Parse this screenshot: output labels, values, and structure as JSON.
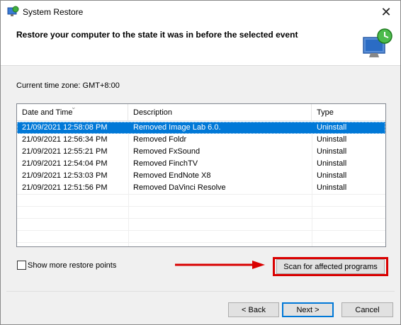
{
  "window": {
    "title": "System Restore",
    "close_glyph": "✕"
  },
  "header": {
    "text": "Restore your computer to the state it was in before the selected event"
  },
  "timezone": "Current time zone: GMT+8:00",
  "table": {
    "columns": [
      "Date and Time",
      "Description",
      "Type"
    ],
    "rows": [
      {
        "date": "21/09/2021 12:58:08 PM",
        "description": "Removed Image Lab 6.0.",
        "type": "Uninstall",
        "selected": true
      },
      {
        "date": "21/09/2021 12:56:34 PM",
        "description": "Removed Foldr",
        "type": "Uninstall"
      },
      {
        "date": "21/09/2021 12:55:21 PM",
        "description": "Removed FxSound",
        "type": "Uninstall"
      },
      {
        "date": "21/09/2021 12:54:04 PM",
        "description": "Removed FinchTV",
        "type": "Uninstall"
      },
      {
        "date": "21/09/2021 12:53:03 PM",
        "description": "Removed EndNote X8",
        "type": "Uninstall"
      },
      {
        "date": "21/09/2021 12:51:56 PM",
        "description": "Removed DaVinci Resolve",
        "type": "Uninstall"
      }
    ]
  },
  "options": {
    "show_more_label": "Show more restore points",
    "scan_label": "Scan for affected programs"
  },
  "buttons": {
    "back": "< Back",
    "next": "Next >",
    "cancel": "Cancel"
  },
  "colors": {
    "selection": "#0078d7",
    "highlight_box": "#d90000",
    "arrow": "#d90000"
  }
}
